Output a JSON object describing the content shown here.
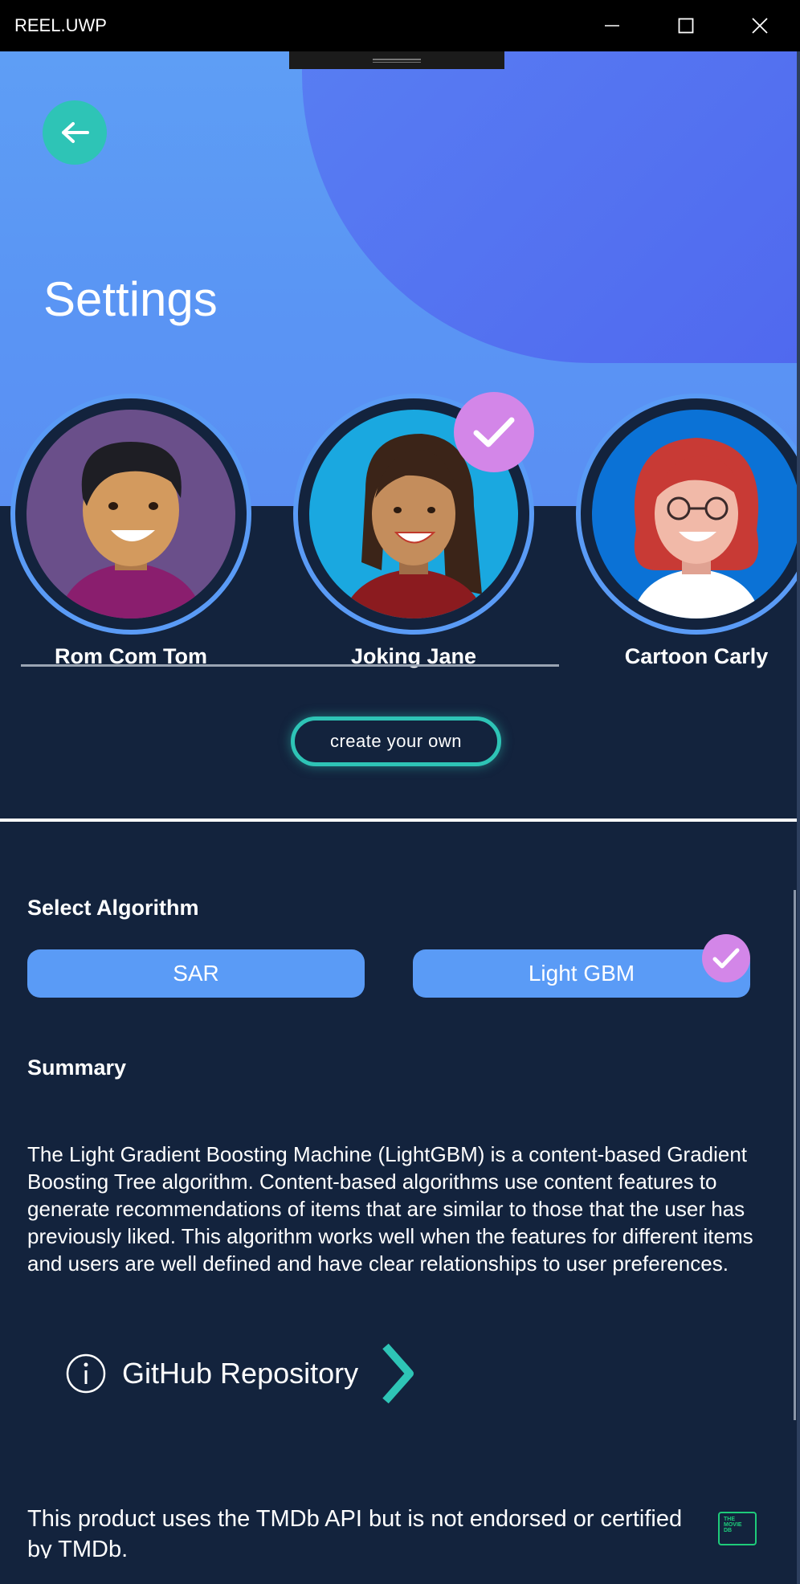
{
  "window": {
    "title": "REEL.UWP",
    "controls": {
      "minimize": "minimize-icon",
      "maximize": "maximize-icon",
      "close": "close-icon"
    }
  },
  "header": {
    "back_icon": "arrow-left-icon",
    "title": "Settings"
  },
  "personas": [
    {
      "name": "Rom Com Tom",
      "selected": false
    },
    {
      "name": "Joking Jane",
      "selected": true
    },
    {
      "name": "Cartoon Carly",
      "selected": false
    }
  ],
  "create_button": "create your own",
  "algorithm": {
    "label": "Select Algorithm",
    "options": [
      "SAR",
      "Light GBM"
    ],
    "selected": "Light GBM"
  },
  "summary": {
    "label": "Summary",
    "text": "The Light Gradient Boosting Machine (LightGBM) is a content-based Gradient Boosting Tree algorithm. Content-based algorithms use content features to generate recommendations of items that are similar to those that the user has previously liked. This algorithm works well when the features for different items and users are well defined and have clear relationships to user preferences."
  },
  "github_link": {
    "label": "GitHub Repository",
    "icon": "info-icon",
    "chevron": "chevron-right-icon"
  },
  "footer": {
    "text": "This product uses the TMDb API but is not endorsed or certified by TMDb.",
    "logo_text": [
      "THE",
      "MOVIE",
      "DB"
    ]
  },
  "colors": {
    "accent_teal": "#2ec4b6",
    "check_purple": "#d386e8",
    "button_blue": "#5a9bf6",
    "background_navy": "#13233d"
  }
}
